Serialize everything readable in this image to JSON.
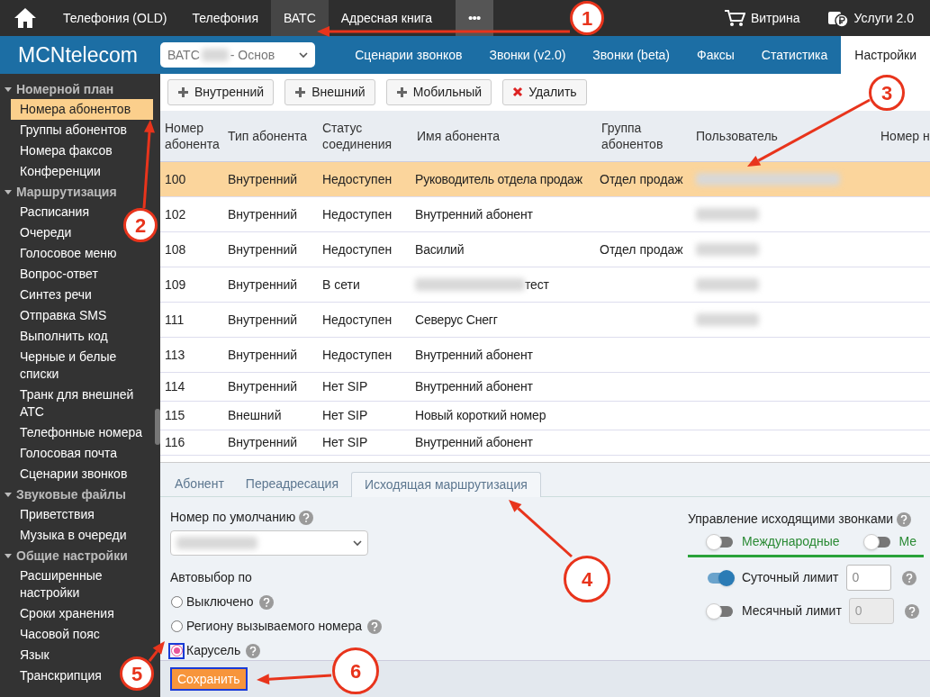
{
  "top_nav": {
    "items": [
      {
        "label": "Телефония (OLD)",
        "selected": false
      },
      {
        "label": "Телефония",
        "selected": false
      },
      {
        "label": "ВАТС",
        "selected": true
      },
      {
        "label": "Адресная книга",
        "selected": false
      }
    ],
    "more": "•••",
    "right": [
      {
        "label": "Витрина",
        "kind": "cart"
      },
      {
        "label": "Услуги 2.0",
        "kind": "services"
      }
    ]
  },
  "app_bar": {
    "logo": "MCNtelecom",
    "select": {
      "prefix": "ВАТС",
      "suffix": "- Основ"
    },
    "tabs": [
      {
        "label": "Сценарии звонков",
        "selected": false
      },
      {
        "label": "Звонки (v2.0)",
        "selected": false
      },
      {
        "label": "Звонки (beta)",
        "selected": false
      },
      {
        "label": "Факсы",
        "selected": false
      },
      {
        "label": "Статистика",
        "selected": false
      },
      {
        "label": "Настройки",
        "selected": true
      }
    ]
  },
  "sidebar": {
    "sections": [
      {
        "title": "Номерной план",
        "expanded": true,
        "items": [
          {
            "label": "Номера абонентов",
            "selected": true
          },
          {
            "label": "Группы абонентов",
            "selected": false
          },
          {
            "label": "Номера факсов",
            "selected": false
          },
          {
            "label": "Конференции",
            "selected": false
          }
        ]
      },
      {
        "title": "Маршрутизация",
        "expanded": true,
        "items": [
          {
            "label": "Расписания",
            "selected": false
          },
          {
            "label": "Очереди",
            "selected": false
          },
          {
            "label": "Голосовое меню",
            "selected": false
          },
          {
            "label": "Вопрос-ответ",
            "selected": false
          },
          {
            "label": "Синтез речи",
            "selected": false
          },
          {
            "label": "Отправка SMS",
            "selected": false
          },
          {
            "label": "Выполнить код",
            "selected": false
          },
          {
            "label": "Черные и белые списки",
            "selected": false
          },
          {
            "label": "Транк для внешней АТС",
            "selected": false
          },
          {
            "label": "Телефонные номера",
            "selected": false
          },
          {
            "label": "Голосовая почта",
            "selected": false
          },
          {
            "label": "Сценарии звонков",
            "selected": false
          }
        ]
      },
      {
        "title": "Звуковые файлы",
        "expanded": true,
        "items": [
          {
            "label": "Приветствия",
            "selected": false
          },
          {
            "label": "Музыка в очереди",
            "selected": false
          }
        ]
      },
      {
        "title": "Общие настройки",
        "expanded": true,
        "items": [
          {
            "label": "Расширенные настройки",
            "selected": false
          },
          {
            "label": "Сроки хранения",
            "selected": false
          },
          {
            "label": "Часовой пояс",
            "selected": false
          },
          {
            "label": "Язык",
            "selected": false
          },
          {
            "label": "Транскрипция",
            "selected": false
          }
        ]
      }
    ]
  },
  "toolbar": [
    {
      "label": "Внутренний",
      "kind": "add"
    },
    {
      "label": "Внешний",
      "kind": "add"
    },
    {
      "label": "Мобильный",
      "kind": "add"
    },
    {
      "label": "Удалить",
      "kind": "delete"
    }
  ],
  "table": {
    "columns": [
      "Номер абонента",
      "Тип абонента",
      "Статус соединения",
      "Имя абонента",
      "Группа абонентов",
      "Пользователь",
      "Номер н"
    ],
    "rows": [
      {
        "number": "100",
        "type": "Внутренний",
        "status": "Недоступен",
        "name": "Руководитель отдела продаж",
        "group": "Отдел продаж",
        "selected": true,
        "user_redacted": true,
        "name_redacted": false
      },
      {
        "number": "102",
        "type": "Внутренний",
        "status": "Недоступен",
        "name": "Внутренний абонент",
        "selected": false,
        "user_redacted": true,
        "name_redacted": false
      },
      {
        "number": "108",
        "type": "Внутренний",
        "status": "Недоступен",
        "name": "Василий",
        "group": "Отдел продаж",
        "selected": false,
        "user_redacted": true,
        "name_redacted": false
      },
      {
        "number": "109",
        "type": "Внутренний",
        "status": "В сети",
        "name": "тест",
        "selected": false,
        "user_redacted": true,
        "name_redacted": true
      },
      {
        "number": "111",
        "type": "Внутренний",
        "status": "Недоступен",
        "name": "Северус Снегг",
        "selected": false,
        "user_redacted": true,
        "name_redacted": false
      },
      {
        "number": "113",
        "type": "Внутренний",
        "status": "Недоступен",
        "name": "Внутренний абонент",
        "selected": false,
        "user_redacted": false,
        "name_redacted": false
      },
      {
        "number": "114",
        "type": "Внутренний",
        "status": "Нет SIP",
        "name": "Внутренний абонент",
        "selected": false,
        "user_redacted": false,
        "name_redacted": false
      },
      {
        "number": "115",
        "type": "Внешний",
        "status": "Нет SIP",
        "name": "Новый короткий номер",
        "selected": false,
        "user_redacted": false,
        "name_redacted": false
      },
      {
        "number": "116",
        "type": "Внутренний",
        "status": "Нет SIP",
        "name": "Внутренний абонент",
        "selected": false,
        "user_redacted": false,
        "name_redacted": false
      }
    ]
  },
  "detail_tabs": [
    {
      "label": "Абонент",
      "selected": false
    },
    {
      "label": "Переадресация",
      "selected": false
    },
    {
      "label": "Исходящая маршрутизация",
      "selected": true
    }
  ],
  "form": {
    "default_number": {
      "label": "Номер по умолчанию"
    },
    "autoselect": {
      "label": "Автовыбор по",
      "options": [
        {
          "label": "Выключено",
          "selected": false
        },
        {
          "label": "Региону вызываемого номера",
          "selected": false
        },
        {
          "label": "Карусель",
          "selected": true
        }
      ]
    },
    "outgoing": {
      "label": "Управление исходящими звонками",
      "categories": [
        {
          "label": "Международные",
          "on": false
        },
        {
          "label": "Ме",
          "on": false
        }
      ],
      "limits": [
        {
          "label": "Суточный лимит",
          "on": true,
          "value": "0",
          "disabled": false
        },
        {
          "label": "Месячный лимит",
          "on": false,
          "value": "0",
          "disabled": true
        }
      ]
    }
  },
  "save_button": "Сохранить",
  "callouts": [
    {
      "number": "1"
    },
    {
      "number": "2"
    },
    {
      "number": "3"
    },
    {
      "number": "4"
    },
    {
      "number": "5"
    },
    {
      "number": "6"
    }
  ]
}
